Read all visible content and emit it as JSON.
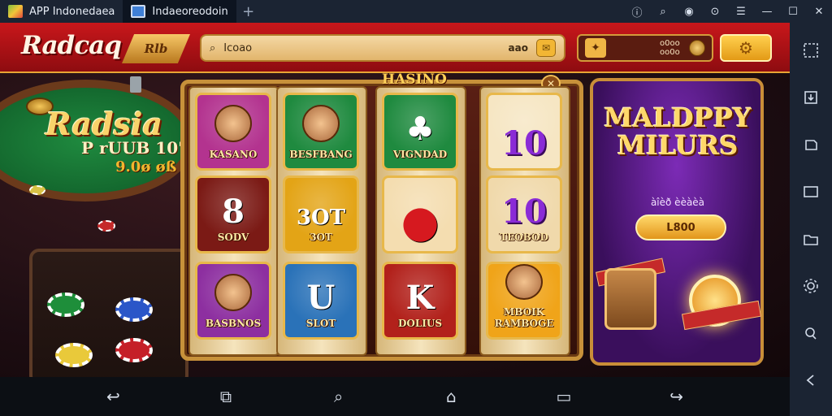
{
  "window": {
    "tabs": [
      {
        "label": "APP Indonedaea"
      },
      {
        "label": "Indaeoreodoin"
      }
    ],
    "add_tab_glyph": "+",
    "controls": [
      "info-icon",
      "search-icon",
      "account-icon",
      "settings-icon",
      "minimize-icon",
      "maximize-icon",
      "close-icon"
    ]
  },
  "header": {
    "logo": "Radcaq",
    "logo_badge": "Rlb",
    "search": {
      "value": "Icoao",
      "counter": "aao"
    },
    "wallet": {
      "amount": "o0oo\noo0o"
    }
  },
  "table": {
    "title": "Radsia",
    "subtitle": "P rUUB 10\"",
    "amount": "9.0ø øß"
  },
  "slot": {
    "banner": "HASINO",
    "reels": [
      [
        {
          "label": "KASANO",
          "bg": "#b3338f"
        },
        {
          "label": "SODV",
          "bg": "#7b1a15",
          "emblem": "8"
        },
        {
          "label": "BASBNOS",
          "bg": "#8d2fa0"
        }
      ],
      [
        {
          "label": "BESFBANG",
          "bg": "#1f8a3f"
        },
        {
          "label": "3OT",
          "bg": "#e3a416",
          "emblem": "3OT"
        },
        {
          "label": "SLOT",
          "bg": "#2a72b8",
          "emblem": "U"
        }
      ],
      [
        {
          "label": "VIGNDAD",
          "bg": "#1f8a3f",
          "emblem": "♣"
        },
        {
          "label": "",
          "bg": "#f4ddb0",
          "emblem": "●"
        },
        {
          "label": "DOLIUS",
          "bg": "#b2211b",
          "emblem": "K"
        }
      ],
      [
        {
          "label": "",
          "bg": "#f6e6c3",
          "emblem": "10"
        },
        {
          "label": "TEOBOD",
          "bg": "#f0d9ab",
          "emblem": "10"
        },
        {
          "label": "MBOIK\nRAMBOGE",
          "bg": "#f0a419"
        }
      ]
    ]
  },
  "promo": {
    "title": "MALDPPY MILURS",
    "subtitle": "àîèð èèàèà",
    "button": "L800"
  },
  "navbar": {
    "buttons": [
      "back-icon",
      "screenshot-icon",
      "search-icon",
      "home-icon",
      "recents-icon",
      "undo-icon"
    ]
  },
  "sidebar": {
    "buttons": [
      "keymap-icon",
      "import-icon",
      "apk-icon",
      "screen-icon",
      "folder-icon",
      "settings-icon",
      "location-icon",
      "back-icon"
    ]
  },
  "colors": {
    "header_red": "#c8171b",
    "gold": "#e9a434",
    "promo_purple": "#7c2bb6",
    "felt_green": "#1f8a3f"
  }
}
